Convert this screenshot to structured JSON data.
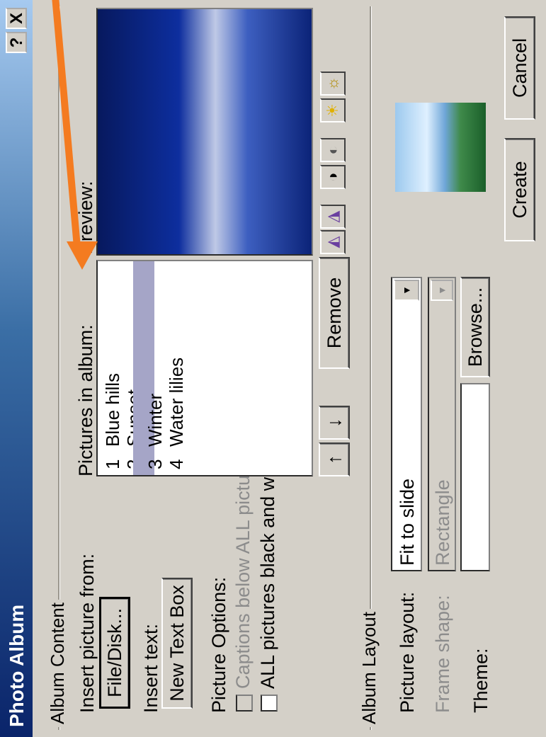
{
  "window": {
    "title": "Photo Album",
    "help": "?",
    "close": "X"
  },
  "album_content": {
    "label": "Album Content",
    "insert_picture_label": "Insert picture from:",
    "file_disk_button": "File/Disk...",
    "insert_text_label": "Insert text:",
    "new_text_box_button": "New Text Box",
    "picture_options_label": "Picture Options:",
    "captions_option": "Captions below ALL pictures",
    "bw_option": "ALL pictures black and white",
    "pictures_label": "Pictures in album:",
    "pictures": [
      {
        "num": "1",
        "name": "Blue hills"
      },
      {
        "num": "2",
        "name": "Sunset"
      },
      {
        "num": "3",
        "name": "Winter",
        "selected": true
      },
      {
        "num": "4",
        "name": "Water lilies"
      }
    ],
    "move_up": "↑",
    "move_down": "↓",
    "remove_button": "Remove",
    "preview_label": "Preview:"
  },
  "album_layout": {
    "label": "Album Layout",
    "picture_layout_label": "Picture layout:",
    "picture_layout_value": "Fit to slide",
    "frame_shape_label": "Frame shape:",
    "frame_shape_value": "Rectangle",
    "theme_label": "Theme:",
    "theme_value": "",
    "browse_button": "Browse..."
  },
  "actions": {
    "create": "Create",
    "cancel": "Cancel"
  },
  "colors": {
    "annotation_arrow": "#f47b20",
    "selection": "#a5a5c7",
    "titlebar": "#0a246a"
  }
}
